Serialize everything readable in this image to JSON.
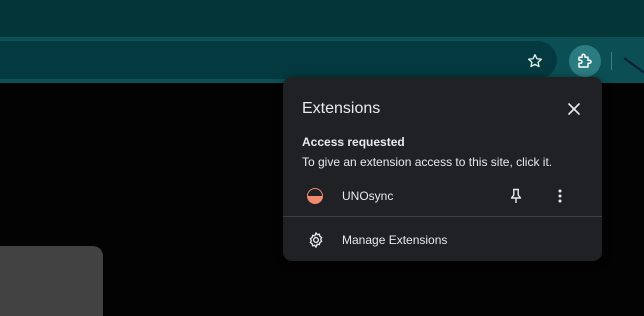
{
  "colors": {
    "tabstrip": "#043538",
    "toolbar": "#0b4f55",
    "omnibox": "#043a3f",
    "popup_bg": "#202124",
    "text": "#e8eaed",
    "extension_icon_accent": "#f28b6e"
  },
  "toolbar": {
    "bookmark_icon": "star-icon",
    "extensions_icon": "puzzle-icon"
  },
  "popup": {
    "title": "Extensions",
    "close_icon": "close-icon",
    "access_section": {
      "title": "Access requested",
      "description": "To give an extension access to this site, click it."
    },
    "extensions": [
      {
        "name": "UNOsync",
        "icon": "unosync-icon",
        "pin_icon": "pin-icon",
        "more_icon": "more-vert-icon"
      }
    ],
    "manage": {
      "label": "Manage Extensions",
      "icon": "gear-icon"
    }
  }
}
